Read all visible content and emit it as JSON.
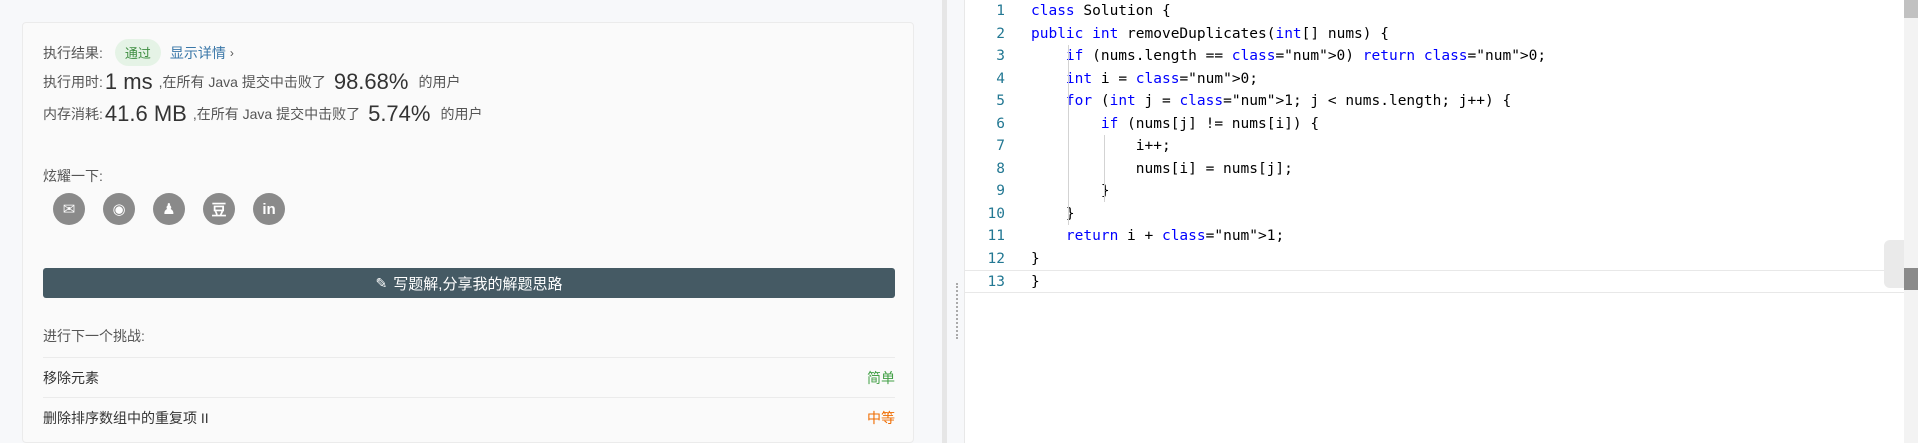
{
  "result": {
    "label": "执行结果:",
    "status": "通过",
    "details_link": "显示详情",
    "chevron": "›"
  },
  "runtime": {
    "label": "执行用时:",
    "value": "1 ms",
    "middle": ",在所有 Java 提交中击败了",
    "percent": "98.68%",
    "suffix": "的用户"
  },
  "memory": {
    "label": "内存消耗:",
    "value": "41.6 MB",
    "middle": ",在所有 Java 提交中击败了",
    "percent": "5.74%",
    "suffix": "的用户"
  },
  "share": {
    "label": "炫耀一下:",
    "icons": [
      {
        "name": "wechat-icon",
        "glyph": "✉"
      },
      {
        "name": "weibo-icon",
        "glyph": "◉"
      },
      {
        "name": "qq-icon",
        "glyph": "♟"
      },
      {
        "name": "douban-icon",
        "glyph": "豆"
      },
      {
        "name": "linkedin-icon",
        "glyph": "in"
      }
    ]
  },
  "write_solution_button": "写题解,分享我的解题思路",
  "next_challenge": {
    "title": "进行下一个挑战:",
    "items": [
      {
        "name": "移除元素",
        "difficulty": "简单"
      },
      {
        "name": "删除排序数组中的重复项 II",
        "difficulty": "中等"
      }
    ]
  },
  "colors": {
    "accent": "#455a64",
    "easy": "#43a047",
    "medium": "#ef6c00",
    "keyword": "#0000ff",
    "number": "#098658"
  },
  "code": {
    "line_numbers": [
      "1",
      "2",
      "3",
      "4",
      "5",
      "6",
      "7",
      "8",
      "9",
      "10",
      "11",
      "12",
      "13"
    ],
    "lines": [
      "class Solution {",
      "public int removeDuplicates(int[] nums) {",
      "    if (nums.length == 0) return 0;",
      "    int i = 0;",
      "    for (int j = 1; j < nums.length; j++) {",
      "        if (nums[j] != nums[i]) {",
      "            i++;",
      "            nums[i] = nums[j];",
      "        }",
      "    }",
      "    return i + 1;",
      "}",
      "}"
    ]
  }
}
